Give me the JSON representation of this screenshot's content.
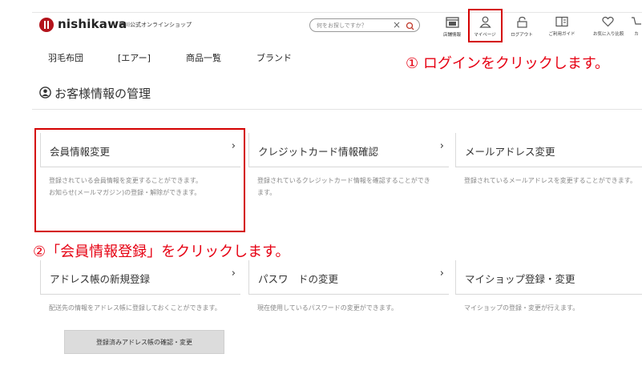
{
  "brand": {
    "name": "nishikawa",
    "subtitle": "西川公式オンラインショップ",
    "color": "#b3131b"
  },
  "search": {
    "placeholder": "何をお探しですか？",
    "clear_icon": "×"
  },
  "header_nav": [
    {
      "id": "store-info",
      "label": "店舗情報",
      "icon": "store-icon"
    },
    {
      "id": "mypage",
      "label": "マイページ",
      "icon": "user-icon"
    },
    {
      "id": "logout",
      "label": "ログアウト",
      "icon": "lock-icon"
    },
    {
      "id": "guide",
      "label": "ご利用ガイド",
      "icon": "book-icon"
    },
    {
      "id": "favorites",
      "label": "お気に入り比較",
      "icon": "heart-icon"
    },
    {
      "id": "cart",
      "label": "カ",
      "icon": "cart-icon"
    }
  ],
  "menu": [
    "羽毛布団",
    "[エアー]",
    "商品一覧",
    "ブランド"
  ],
  "annotations": {
    "step1": "① ログインをクリックします。",
    "step2": "②「会員情報登録」をクリックします。",
    "accent": "#e60012"
  },
  "page": {
    "title": "お客様情報の管理"
  },
  "cards": [
    {
      "title": "会員情報変更",
      "desc": [
        "登録されている会員情報を変更することができます。",
        "お知らせ(メールマガジン)の登録・解除ができます。"
      ]
    },
    {
      "title": "クレジットカード情報確認",
      "desc": [
        "登録されているクレジットカード情報を確認することができます。"
      ]
    },
    {
      "title": "メールアドレス変更",
      "desc": [
        "登録されているメールアドレスを変更することができます。"
      ]
    },
    {
      "title": "アドレス帳の新規登録",
      "desc": [
        "配送先の情報をアドレス帳に登録しておくことができます。"
      ]
    },
    {
      "title": "パスワ　ドの変更",
      "desc": [
        "現在使用しているパスワードの変更ができます。"
      ]
    },
    {
      "title": "マイショップ登録・変更",
      "desc": [
        "マイショップの登録・変更が行えます。"
      ]
    }
  ],
  "chevron": "›",
  "address_book_button": "登録済みアドレス帳の確認・変更"
}
